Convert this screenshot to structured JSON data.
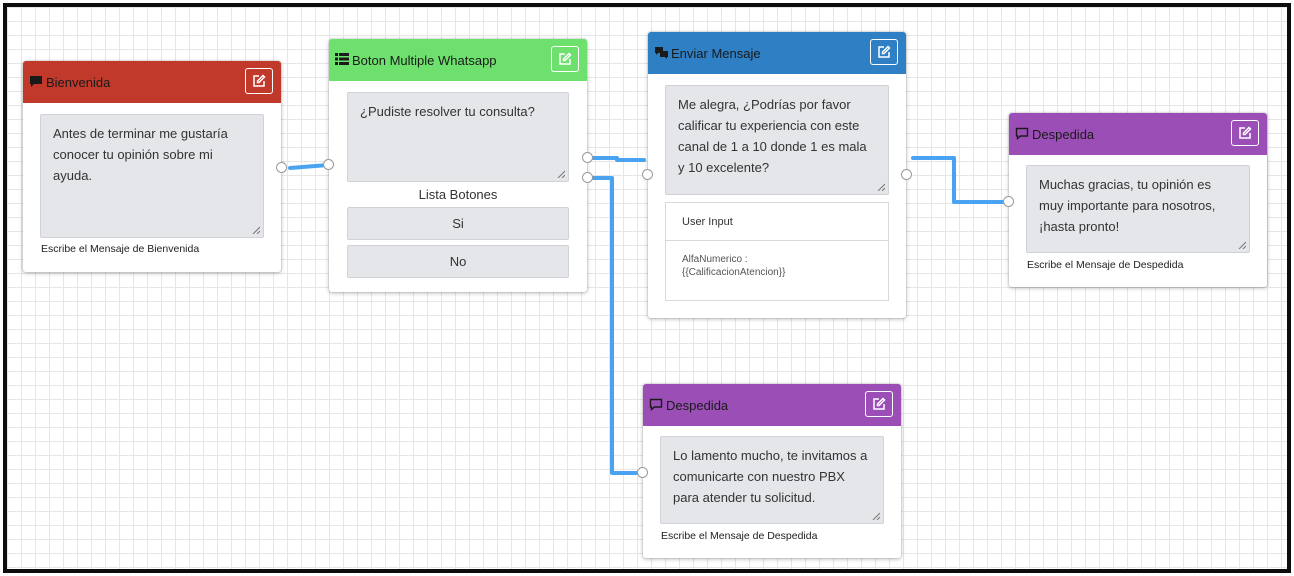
{
  "colors": {
    "bienvenida": "#c0392b",
    "boton_multiple": "#6ee06e",
    "enviar_mensaje": "#2e7fc4",
    "despedida": "#9b4fb6",
    "connector": "#4aa3f0"
  },
  "nodes": {
    "bienvenida": {
      "title": "Bienvenida",
      "icon": "comment-icon",
      "message": "Antes de terminar me gustaría conocer tu opinión sobre mi ayuda.",
      "caption": "Escribe el Mensaje de Bienvenida"
    },
    "boton_multiple": {
      "title": "Boton Multiple Whatsapp",
      "icon": "list-icon",
      "message": "¿Pudiste resolver tu consulta?",
      "list_label": "Lista Botones",
      "buttons": [
        "Si",
        "No"
      ]
    },
    "enviar_mensaje": {
      "title": "Enviar Mensaje",
      "icon": "comments-icon",
      "message": "Me alegra, ¿Podrías por favor calificar tu experiencia con este canal de 1 a 10 donde 1 es mala y 10 excelente?",
      "user_input_label": "User Input",
      "input_type": "AlfaNumerico :",
      "variable": "{{CalificacionAtencion}}"
    },
    "despedida_top": {
      "title": "Despedida",
      "icon": "comment-outline-icon",
      "message": "Muchas gracias, tu opinión es muy importante para nosotros, ¡hasta pronto!",
      "caption": "Escribe el Mensaje de Despedida"
    },
    "despedida_bottom": {
      "title": "Despedida",
      "icon": "comment-outline-icon",
      "message": "Lo lamento mucho, te invitamos a comunicarte con nuestro PBX para atender tu solicitud.",
      "caption": "Escribe el Mensaje de Despedida"
    }
  }
}
